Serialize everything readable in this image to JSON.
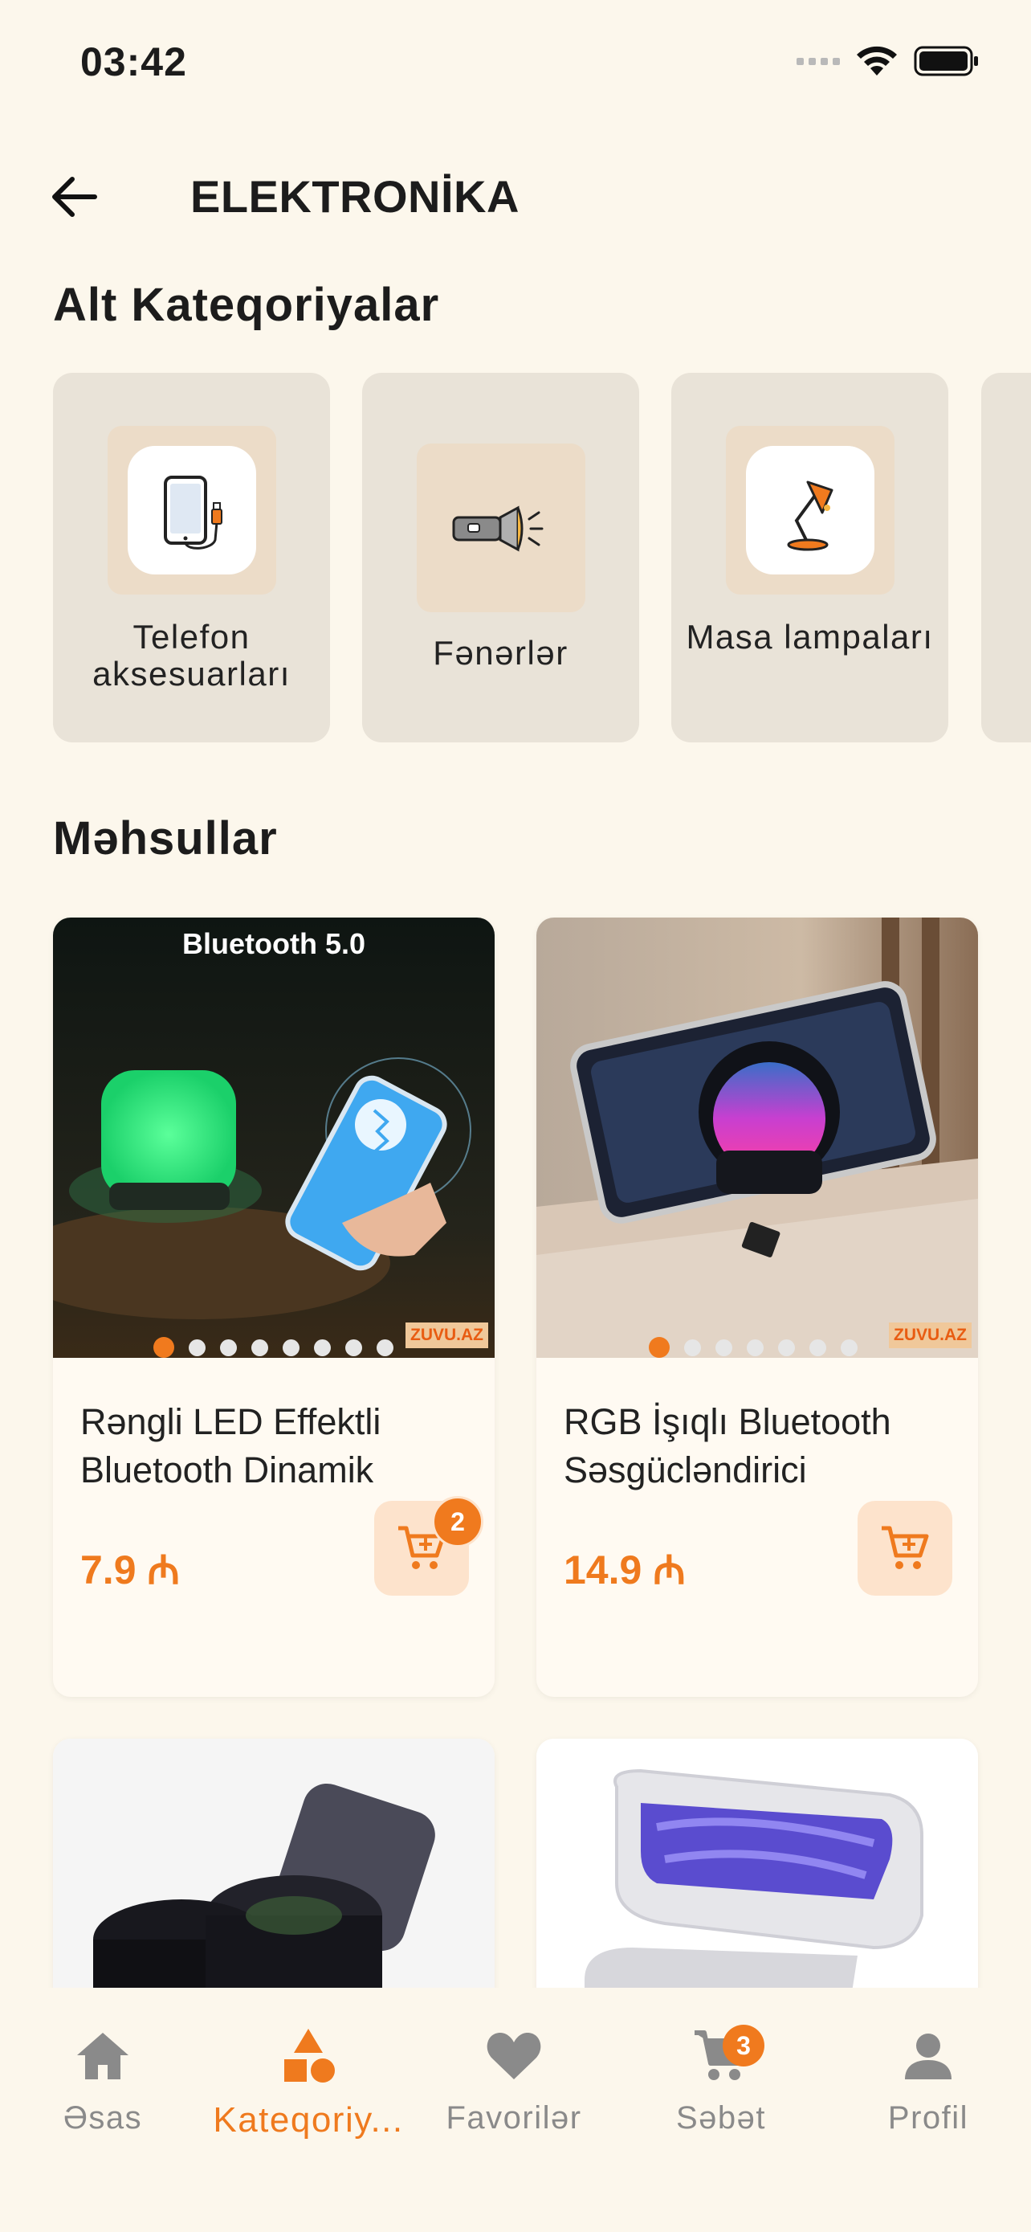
{
  "status_bar": {
    "time": "03:42"
  },
  "header": {
    "title": "ELEKTRONİKA"
  },
  "subcategories": {
    "title": "Alt Kateqoriyalar",
    "items": [
      {
        "label": "Telefon aksesuarları",
        "icon": "phone-charger-icon"
      },
      {
        "label": "Fənərlər",
        "icon": "flashlight-icon"
      },
      {
        "label": "Masa lampaları",
        "icon": "desk-lamp-icon"
      }
    ]
  },
  "products": {
    "title": "Məhsullar",
    "items": [
      {
        "name": "Rəngli LED Effektli Bluetooth Dinamik",
        "price": "7.9 ₼",
        "cart_count": "2",
        "image_caption": "Bluetooth 5.0",
        "watermark": "ZUVU.AZ"
      },
      {
        "name": "RGB İşıqlı Bluetooth Səsgücləndirici",
        "price": "14.9 ₼",
        "watermark": "ZUVU.AZ"
      }
    ]
  },
  "bottom_nav": {
    "items": [
      {
        "label": "Əsas",
        "icon": "home-icon"
      },
      {
        "label": "Kateqoriy...",
        "icon": "categories-icon",
        "active": true
      },
      {
        "label": "Favorilər",
        "icon": "heart-icon"
      },
      {
        "label": "Səbət",
        "icon": "cart-icon",
        "badge": "3"
      },
      {
        "label": "Profil",
        "icon": "profile-icon"
      }
    ]
  },
  "colors": {
    "accent": "#ef7a1e",
    "background": "#fcf7ec",
    "card": "#e9e3d8"
  }
}
